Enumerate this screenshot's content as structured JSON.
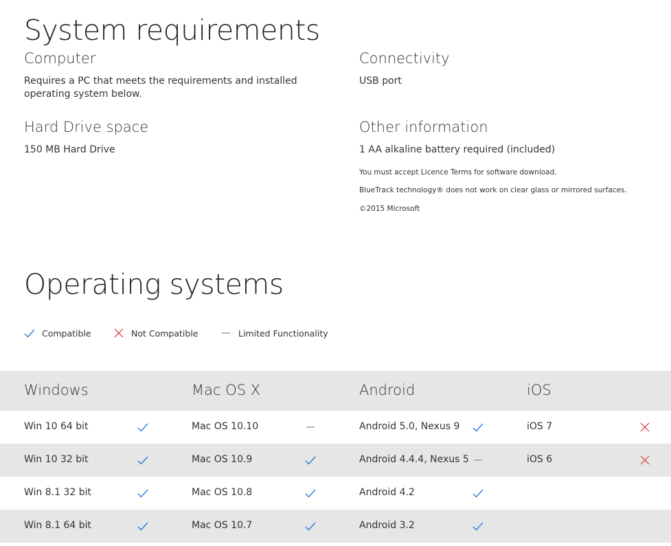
{
  "sysreq": {
    "title": "System requirements",
    "computer": {
      "heading": "Computer",
      "text_line1": "Requires a PC that meets the requirements and installed",
      "text_line2": "operating system below."
    },
    "connectivity": {
      "heading": "Connectivity",
      "text": "USB port"
    },
    "harddrive": {
      "heading": "Hard Drive space",
      "text": "150 MB Hard Drive"
    },
    "other": {
      "heading": "Other information",
      "text": "1 AA alkaline battery required (included)",
      "notes": [
        "You must accept Licence Terms for software download.",
        "BlueTrack technology® does not work on clear glass or mirrored surfaces.",
        "©2015 Microsoft"
      ]
    }
  },
  "os": {
    "title": "Operating systems",
    "legend": {
      "compatible": "Compatible",
      "not_compatible": "Not Compatible",
      "limited": "Limited Functionality"
    },
    "colors": {
      "check": "#2b7bd6",
      "cross": "#e05252",
      "dash": "#999999",
      "band": "#e6e6e6"
    },
    "columns": [
      "Windows",
      "Mac OS X",
      "Android",
      "iOS"
    ],
    "rows": [
      [
        {
          "name": "Win 10 64 bit",
          "status": "check-icon"
        },
        {
          "name": "Mac OS 10.10",
          "status": "dash-icon"
        },
        {
          "name": "Android 5.0, Nexus 9",
          "status": "check-icon"
        },
        {
          "name": "iOS 7",
          "status": "cross-icon"
        }
      ],
      [
        {
          "name": "Win 10 32 bit",
          "status": "check-icon"
        },
        {
          "name": "Mac OS 10.9",
          "status": "check-icon"
        },
        {
          "name": "Android 4.4.4, Nexus 5",
          "status": "dash-icon"
        },
        {
          "name": "iOS 6",
          "status": "cross-icon"
        }
      ],
      [
        {
          "name": "Win 8.1 32 bit",
          "status": "check-icon"
        },
        {
          "name": "Mac OS 10.8",
          "status": "check-icon"
        },
        {
          "name": "Android 4.2",
          "status": "check-icon"
        },
        {
          "name": "",
          "status": ""
        }
      ],
      [
        {
          "name": "Win 8.1 64 bit",
          "status": "check-icon"
        },
        {
          "name": "Mac OS 10.7",
          "status": "check-icon"
        },
        {
          "name": "Android 3.2",
          "status": "check-icon"
        },
        {
          "name": "",
          "status": ""
        }
      ]
    ]
  }
}
